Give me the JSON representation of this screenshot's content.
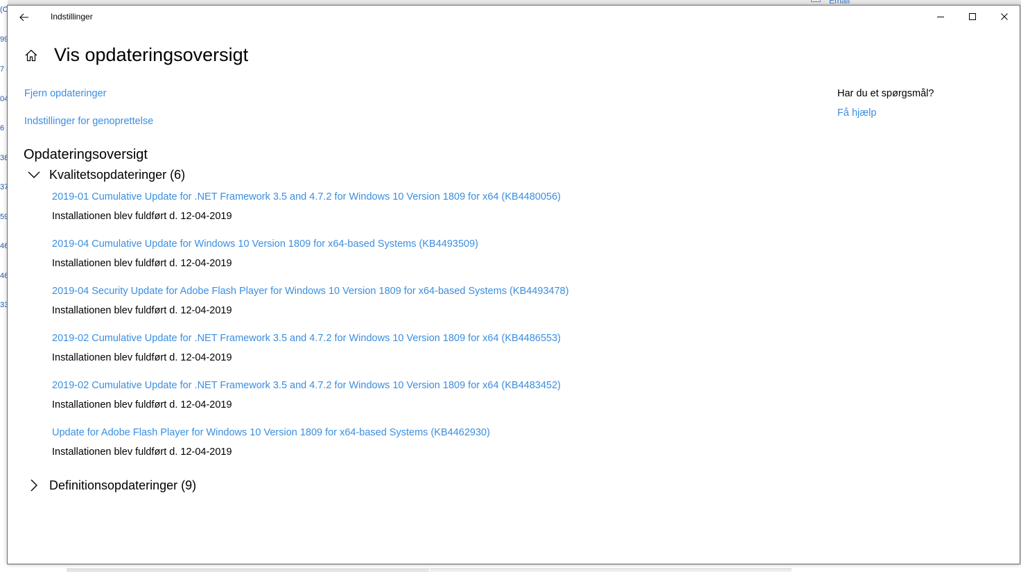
{
  "background": {
    "left_fragments": [
      "(C",
      "99",
      "7 (",
      "04",
      "6",
      "38",
      "37",
      "59",
      "46",
      "46",
      "33"
    ],
    "top_right_label": "Email"
  },
  "window": {
    "title": "Indstillinger",
    "icons": {
      "back": "back-arrow-icon",
      "minimize": "minimize-icon",
      "maximize": "maximize-icon",
      "close": "close-icon",
      "home": "home-icon"
    }
  },
  "page": {
    "title": "Vis opdateringsoversigt",
    "links": {
      "uninstall": "Fjern opdateringer",
      "recovery": "Indstillinger for genoprettelse"
    },
    "section_title": "Opdateringsoversigt",
    "groups": {
      "quality": {
        "label": "Kvalitetsopdateringer (6)",
        "expanded": true,
        "items": [
          {
            "name": "2019-01 Cumulative Update for .NET Framework 3.5 and 4.7.2 for Windows 10 Version 1809 for x64 (KB4480056)",
            "status": "Installationen blev fuldført d. 12-04-2019"
          },
          {
            "name": "2019-04 Cumulative Update for Windows 10 Version 1809 for x64-based Systems (KB4493509)",
            "status": "Installationen blev fuldført d. 12-04-2019"
          },
          {
            "name": "2019-04 Security Update for Adobe Flash Player for Windows 10 Version 1809 for x64-based Systems (KB4493478)",
            "status": "Installationen blev fuldført d. 12-04-2019"
          },
          {
            "name": "2019-02 Cumulative Update for .NET Framework 3.5 and 4.7.2 for Windows 10 Version 1809 for x64 (KB4486553)",
            "status": "Installationen blev fuldført d. 12-04-2019"
          },
          {
            "name": "2019-02 Cumulative Update for .NET Framework 3.5 and 4.7.2 for Windows 10 Version 1809 for x64 (KB4483452)",
            "status": "Installationen blev fuldført d. 12-04-2019"
          },
          {
            "name": "Update for Adobe Flash Player for Windows 10 Version 1809 for x64-based Systems (KB4462930)",
            "status": "Installationen blev fuldført d. 12-04-2019"
          }
        ]
      },
      "definition": {
        "label": "Definitionsopdateringer (9)",
        "expanded": false
      }
    },
    "help": {
      "question": "Har du et spørgsmål?",
      "link": "Få hjælp"
    }
  },
  "colors": {
    "link": "#3a8ee0",
    "text": "#000000",
    "window_bg": "#ffffff"
  }
}
